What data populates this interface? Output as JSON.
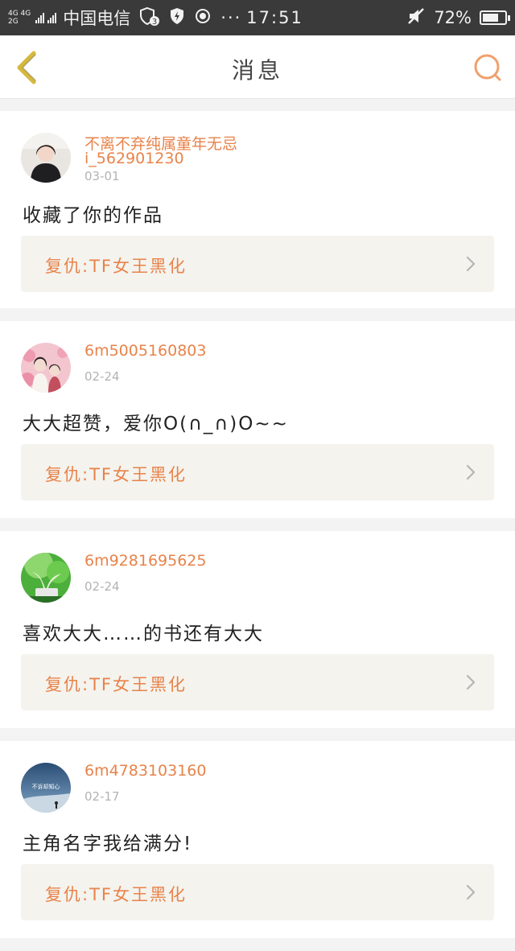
{
  "status_bar": {
    "net_top": "4G 4G",
    "net_bottom": "2G",
    "carrier": "中国电信",
    "badge": "3",
    "dots": "···",
    "time": "17:51",
    "battery": "72%",
    "battery_level": 0.72
  },
  "header": {
    "title": "消息"
  },
  "messages": [
    {
      "username": "不离不弃纯属童年无忌",
      "user_id": "i_562901230",
      "date": "03-01",
      "comment": "收藏了你的作品",
      "reply": "复仇:TF女王黑化"
    },
    {
      "username": "6m5005160803",
      "date": "02-24",
      "comment": "大大超赞，爱你O(∩_∩)O~~",
      "reply": "复仇:TF女王黑化"
    },
    {
      "username": "6m9281695625",
      "date": "02-24",
      "comment": "喜欢大大……的书还有大大",
      "reply": "复仇:TF女王黑化"
    },
    {
      "username": "6m4783103160",
      "date": "02-17",
      "comment": "主角名字我给满分!",
      "reply": "复仇:TF女王黑化",
      "avatar_text": "不诉却知心"
    }
  ],
  "colors": {
    "accent": "#e8834a",
    "status_bg": "#3a3a3a",
    "reply_bg": "#f4f3ee"
  }
}
